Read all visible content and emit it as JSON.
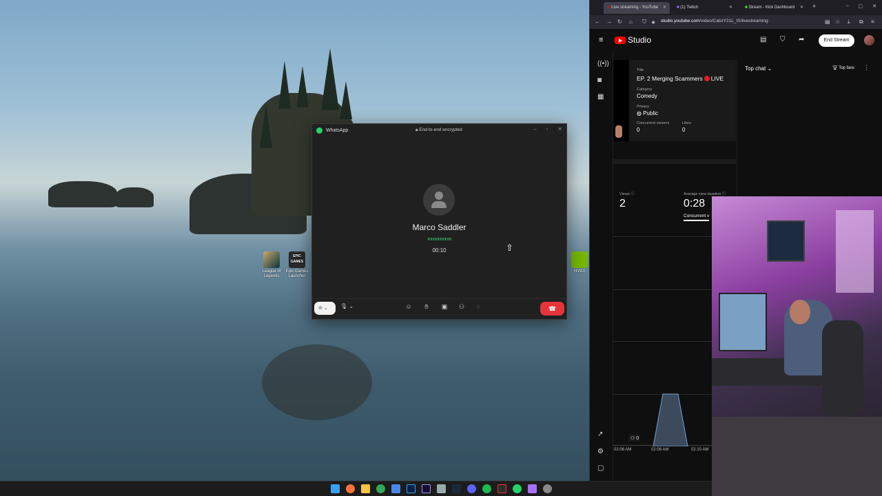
{
  "desktop": {
    "icons": [
      {
        "label": "League of Legends",
        "name": "league-of-legends-icon"
      },
      {
        "label": "Epic Games Launcher",
        "name": "epic-games-icon",
        "badge": "EPIC GAMES"
      },
      {
        "label": "NVIDI",
        "name": "nvidia-icon"
      }
    ]
  },
  "whatsapp": {
    "app_title": "WhatsApp",
    "encryption": "End-to-end encrypted",
    "caller_name": "Marco Saddler",
    "call_timer": "00:10",
    "colors": {
      "accent": "#25d366",
      "end_call": "#e5343a"
    }
  },
  "browser": {
    "tabs": [
      {
        "title": "Live streaming - YouTube",
        "active": true
      },
      {
        "title": "(1) Twitch",
        "active": false
      },
      {
        "title": "Stream - Kick Dashboard",
        "active": false
      }
    ],
    "url_domain": "studio.youtube.com",
    "url_path": "/video/CabzY21L_tS/livestreaming"
  },
  "studio": {
    "logo_text": "Studio",
    "end_stream_label": "End Stream",
    "stream": {
      "title_label": "Title",
      "title": "EP. 2 Merging Scammers",
      "live_label": "LIVE",
      "category_label": "Category",
      "category": "Comedy",
      "privacy_label": "Privacy",
      "privacy": "Public",
      "concurrent_label": "Concurrent viewers",
      "concurrent_value": "0",
      "likes_label": "Likes",
      "likes_value": "0"
    },
    "chat": {
      "mode": "Top chat",
      "top_fans": "Top fans"
    },
    "stats": {
      "views_label": "Views",
      "views_value": "2",
      "avg_label": "Average view duration",
      "avg_value": "0:28",
      "concurrent_tab": "Concurrent v"
    },
    "chart": {
      "viewer_count": "0",
      "ticks": [
        "02:06 AM",
        "02:08 AM",
        "02:10 AM"
      ]
    }
  }
}
